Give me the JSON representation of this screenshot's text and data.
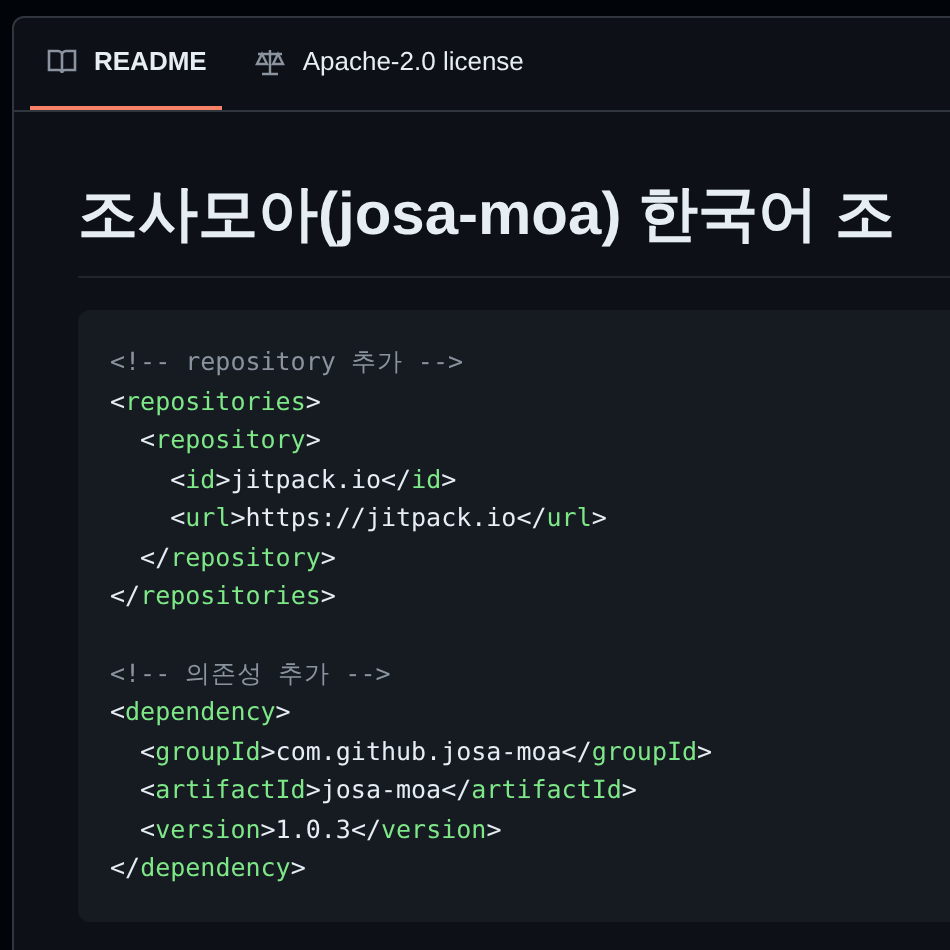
{
  "tabs": [
    {
      "label": "README",
      "kind": "readme",
      "selected": true
    },
    {
      "label": "Apache-2.0 license",
      "kind": "license",
      "selected": false
    }
  ],
  "heading": "조사모아(josa-moa) 한국어 조",
  "code_blocks": [
    [
      [
        {
          "kind": "comment",
          "text": "<!-- repository 추가 -->"
        }
      ],
      [
        {
          "kind": "punct",
          "text": "<"
        },
        {
          "kind": "tag",
          "text": "repositories"
        },
        {
          "kind": "punct",
          "text": ">"
        }
      ],
      [
        {
          "kind": "punct",
          "text": "  <"
        },
        {
          "kind": "tag",
          "text": "repository"
        },
        {
          "kind": "punct",
          "text": ">"
        }
      ],
      [
        {
          "kind": "punct",
          "text": "    <"
        },
        {
          "kind": "tag",
          "text": "id"
        },
        {
          "kind": "punct",
          "text": ">"
        },
        {
          "kind": "text",
          "text": "jitpack.io"
        },
        {
          "kind": "punct",
          "text": "</"
        },
        {
          "kind": "tag",
          "text": "id"
        },
        {
          "kind": "punct",
          "text": ">"
        }
      ],
      [
        {
          "kind": "punct",
          "text": "    <"
        },
        {
          "kind": "tag",
          "text": "url"
        },
        {
          "kind": "punct",
          "text": ">"
        },
        {
          "kind": "text",
          "text": "https://jitpack.io"
        },
        {
          "kind": "punct",
          "text": "</"
        },
        {
          "kind": "tag",
          "text": "url"
        },
        {
          "kind": "punct",
          "text": ">"
        }
      ],
      [
        {
          "kind": "punct",
          "text": "  </"
        },
        {
          "kind": "tag",
          "text": "repository"
        },
        {
          "kind": "punct",
          "text": ">"
        }
      ],
      [
        {
          "kind": "punct",
          "text": "</"
        },
        {
          "kind": "tag",
          "text": "repositories"
        },
        {
          "kind": "punct",
          "text": ">"
        }
      ]
    ],
    [
      [
        {
          "kind": "comment",
          "text": "<!-- 의존성 추가 -->"
        }
      ],
      [
        {
          "kind": "punct",
          "text": "<"
        },
        {
          "kind": "tag",
          "text": "dependency"
        },
        {
          "kind": "punct",
          "text": ">"
        }
      ],
      [
        {
          "kind": "punct",
          "text": "  <"
        },
        {
          "kind": "tag",
          "text": "groupId"
        },
        {
          "kind": "punct",
          "text": ">"
        },
        {
          "kind": "text",
          "text": "com.github.josa-moa"
        },
        {
          "kind": "punct",
          "text": "</"
        },
        {
          "kind": "tag",
          "text": "groupId"
        },
        {
          "kind": "punct",
          "text": ">"
        }
      ],
      [
        {
          "kind": "punct",
          "text": "  <"
        },
        {
          "kind": "tag",
          "text": "artifactId"
        },
        {
          "kind": "punct",
          "text": ">"
        },
        {
          "kind": "text",
          "text": "josa-moa"
        },
        {
          "kind": "punct",
          "text": "</"
        },
        {
          "kind": "tag",
          "text": "artifactId"
        },
        {
          "kind": "punct",
          "text": ">"
        }
      ],
      [
        {
          "kind": "punct",
          "text": "  <"
        },
        {
          "kind": "tag",
          "text": "version"
        },
        {
          "kind": "punct",
          "text": ">"
        },
        {
          "kind": "text",
          "text": "1.0.3"
        },
        {
          "kind": "punct",
          "text": "</"
        },
        {
          "kind": "tag",
          "text": "version"
        },
        {
          "kind": "punct",
          "text": ">"
        }
      ],
      [
        {
          "kind": "punct",
          "text": "</"
        },
        {
          "kind": "tag",
          "text": "dependency"
        },
        {
          "kind": "punct",
          "text": ">"
        }
      ]
    ]
  ]
}
